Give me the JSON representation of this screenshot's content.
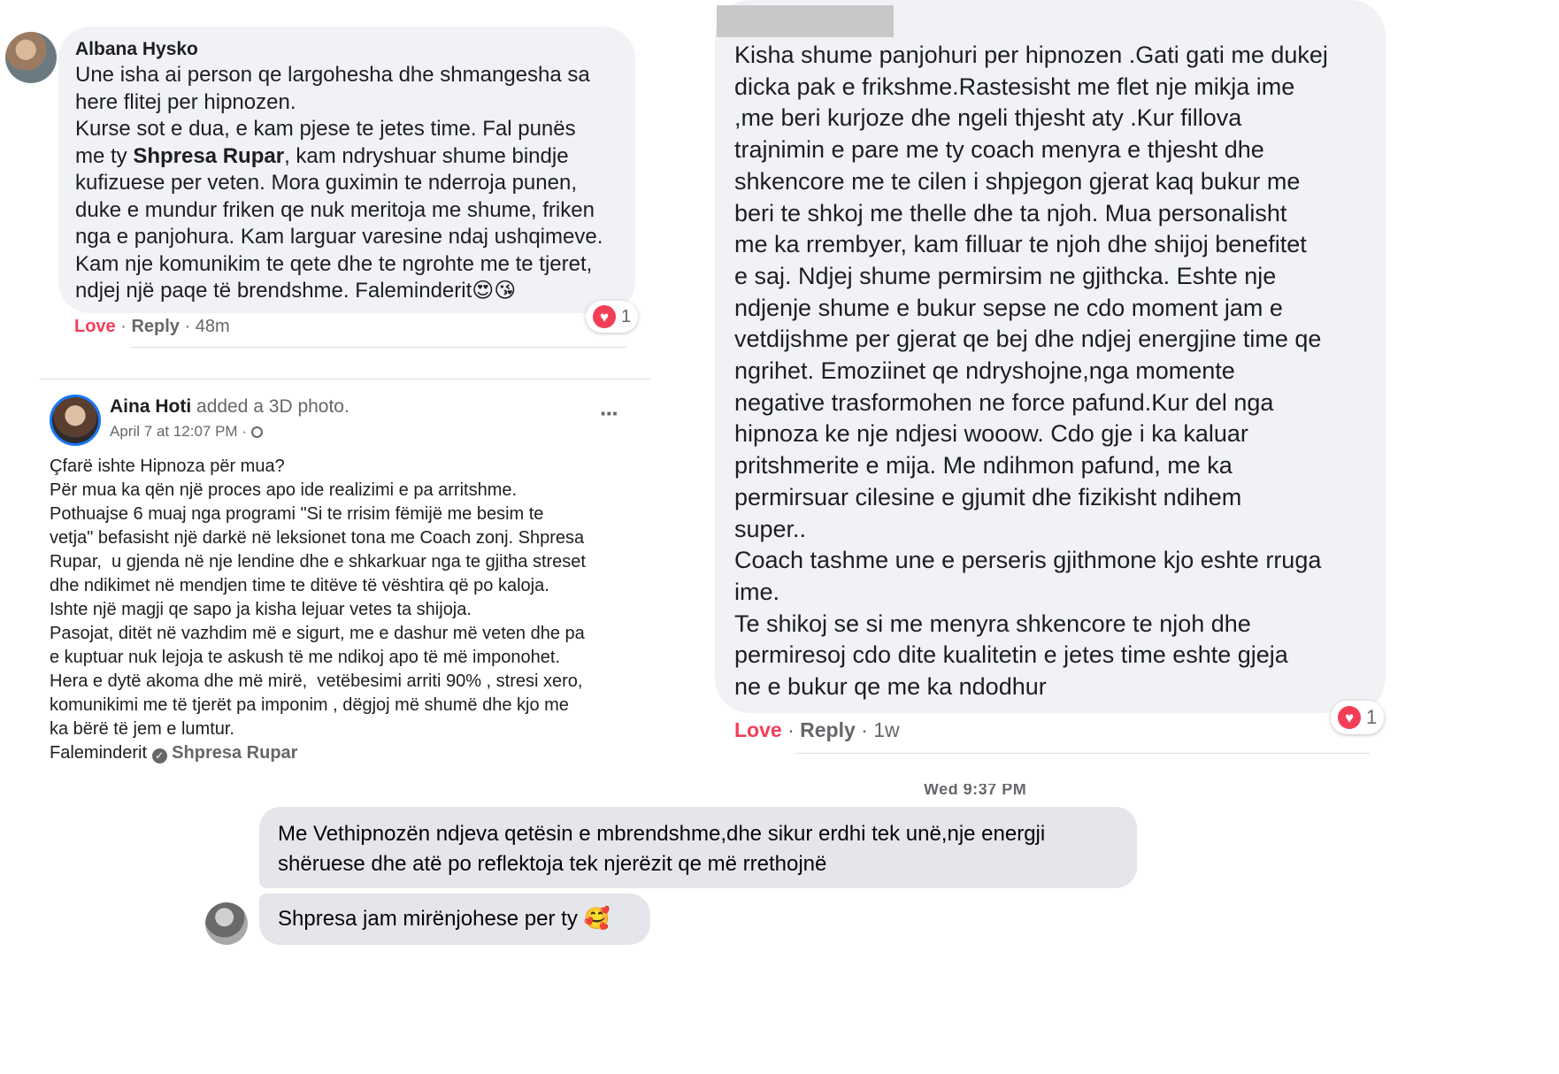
{
  "comment1": {
    "author": "Albana Hysko",
    "lines": [
      "Une isha ai person qe largohesha dhe shmangesha sa",
      "here flitej per hipnozen.",
      "Kurse sot e dua, e kam pjese te jetes time. Fal punës"
    ],
    "line4_pre": "me ty ",
    "mention": "Shpresa Rupar",
    "line4_post": ", kam ndryshuar shume bindje",
    "lines_after": [
      "kufizuese per veten. Mora guximin te nderroja punen,",
      "duke e mundur friken qe nuk meritoja me shume, friken",
      "nga e panjohura. Kam larguar varesine ndaj ushqimeve.",
      "Kam nje komunikim te qete dhe te ngrohte me te tjeret,"
    ],
    "last_line": "ndjej një paqe të brendshme. Faleminderit",
    "emojis": "😍😘",
    "love_label": "Love",
    "reply_label": "Reply",
    "time": "48m",
    "reaction_count": "1"
  },
  "post": {
    "author": "Aina Hoti",
    "action": "added a 3D photo.",
    "date": "April 7 at 12:07 PM",
    "privacy_icon": "globe-icon",
    "more_label": "···",
    "lines": [
      "Çfarë ishte Hipnoza për mua?",
      "Për mua ka qën një proces apo ide realizimi e pa arritshme.",
      "Pothuajse 6 muaj nga programi \"Si te rrisim fëmijë me besim te",
      "vetja\" befasisht një darkë në leksionet tona me Coach zonj. Shpresa",
      "Rupar,  u gjenda në nje lendine dhe e shkarkuar nga te gjitha streset",
      "dhe ndikimet në mendjen time te ditëve të vështira që po kaloja.",
      "Ishte një magji qe sapo ja kisha lejuar vetes ta shijoja.",
      "Pasojat, ditët në vazhdim më e sigurt, me e dashur më veten dhe pa",
      "e kuptuar nuk lejoja te askush të me ndikoj apo të më imponohet.",
      "Hera e dytë akoma dhe më mirë,  vetëbesimi arriti 90% , stresi xero,",
      "komunikimi me të tjerët pa imponim , dëgjoj më shumë dhe kjo me",
      "ka bërë të jem e lumtur."
    ],
    "thanks": "Faleminderit",
    "tag": "Shpresa Rupar"
  },
  "comment2": {
    "lines": [
      "Kisha shume panjohuri per hipnozen .Gati gati me dukej",
      "dicka pak e frikshme.Rastesisht me flet nje mikja ime",
      ",me beri kurjoze dhe ngeli thjesht aty .Kur fillova",
      "trajnimin e pare me ty coach menyra e thjesht dhe",
      "shkencore me te cilen i shpjegon gjerat kaq bukur me",
      "beri te shkoj me thelle dhe ta njoh. Mua personalisht",
      "me ka rrembyer, kam filluar te njoh dhe shijoj benefitet",
      "e saj. Ndjej shume permirsim ne gjithcka. Eshte nje",
      "ndjenje shume e bukur sepse ne cdo moment jam e",
      "vetdijshme per gjerat qe bej dhe ndjej energjine time qe",
      "ngrihet. Emoziinet qe ndryshojne,nga momente",
      "negative trasformohen ne force pafund.Kur del nga",
      "hipnoza ke nje ndjesi wooow. Cdo gje i ka kaluar",
      "pritshmerite e mija. Me ndihmon pafund, me ka",
      "permirsuar cilesine e gjumit dhe fizikisht ndihem",
      "super..",
      "Coach tashme une e perseris gjithmone kjo eshte rruga",
      "ime.",
      "Te shikoj se si me menyra shkencore te njoh dhe",
      "permiresoj cdo dite kualitetin e jetes time eshte gjeja",
      "ne e bukur qe me ka ndodhur"
    ],
    "love_label": "Love",
    "reply_label": "Reply",
    "time": "1w",
    "reaction_count": "1"
  },
  "messenger": {
    "timestamp": "Wed 9:37 PM",
    "msg1_lines": [
      "Me Vethipnozën ndjeva qetësin e mbrendshme,dhe sikur erdhi tek unë,nje energji",
      "shëruese dhe atë po reflektoja tek njerëzit qe më rrethojnë"
    ],
    "msg2": "Shpresa jam mirënjohese per ty",
    "msg2_emoji": "🥰"
  },
  "colors": {
    "love_red": "#f33e58",
    "bubble_bg": "#f0f2f5",
    "meta_gray": "#65676b",
    "avatar_ring": "#1877f2"
  }
}
